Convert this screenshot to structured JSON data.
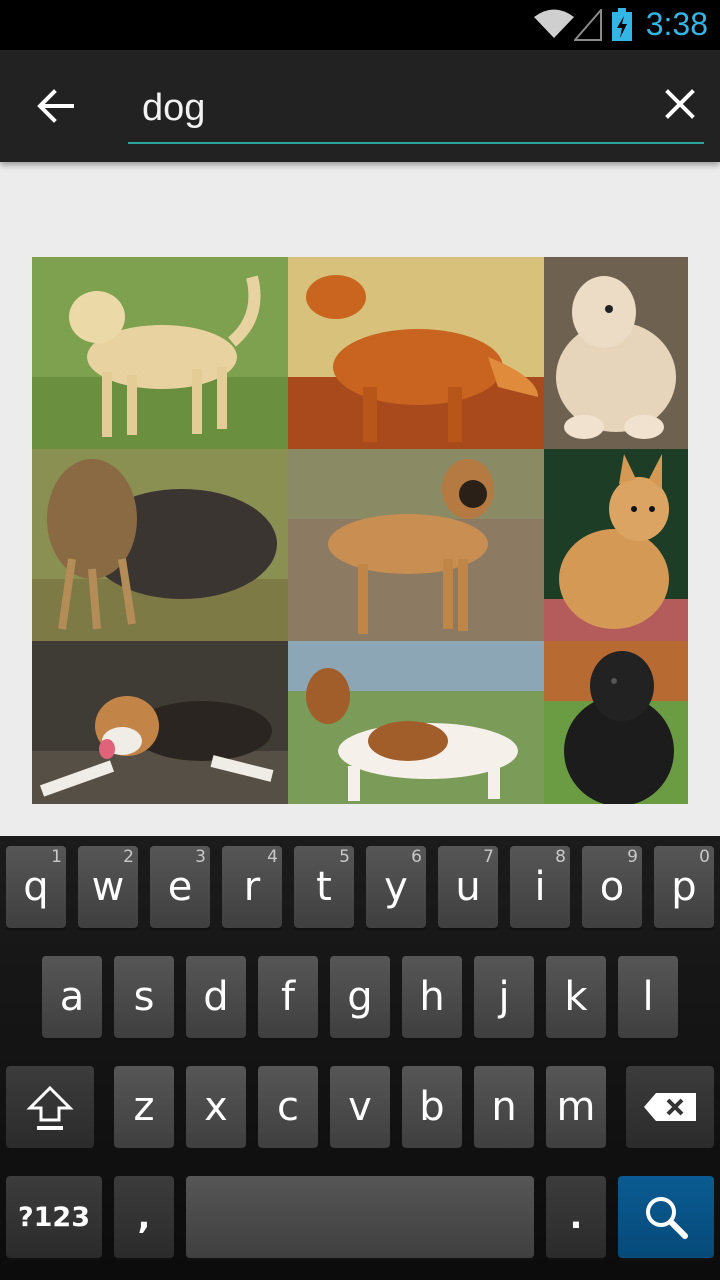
{
  "status_bar": {
    "time": "3:38",
    "time_color": "#33b5e5",
    "icons": [
      "wifi-icon",
      "cellular-signal-icon",
      "battery-charging-icon"
    ]
  },
  "search": {
    "query": "dog",
    "back_icon": "arrow-back-icon",
    "clear_icon": "close-icon",
    "underline_color": "#2aa39a"
  },
  "results": {
    "images": [
      {
        "subject": "yellow labrador"
      },
      {
        "subject": "golden retriever"
      },
      {
        "subject": "cream cockapoo"
      },
      {
        "subject": "yorkshire terrier"
      },
      {
        "subject": "boxer"
      },
      {
        "subject": "pomeranian"
      },
      {
        "subject": "beagle"
      },
      {
        "subject": "basset hound"
      },
      {
        "subject": "newfoundland"
      }
    ]
  },
  "keyboard": {
    "row1": [
      {
        "key": "q",
        "hint": "1"
      },
      {
        "key": "w",
        "hint": "2"
      },
      {
        "key": "e",
        "hint": "3"
      },
      {
        "key": "r",
        "hint": "4"
      },
      {
        "key": "t",
        "hint": "5"
      },
      {
        "key": "y",
        "hint": "6"
      },
      {
        "key": "u",
        "hint": "7"
      },
      {
        "key": "i",
        "hint": "8"
      },
      {
        "key": "o",
        "hint": "9"
      },
      {
        "key": "p",
        "hint": "0"
      }
    ],
    "row2": [
      "a",
      "s",
      "d",
      "f",
      "g",
      "h",
      "j",
      "k",
      "l"
    ],
    "row3": [
      "z",
      "x",
      "c",
      "v",
      "b",
      "n",
      "m"
    ],
    "symbols_label": "?123",
    "comma_label": ",",
    "period_label": ".",
    "shift_icon": "shift-arrow-icon",
    "delete_icon": "backspace-icon",
    "search_icon": "search-icon",
    "action_color": "#064a79"
  }
}
